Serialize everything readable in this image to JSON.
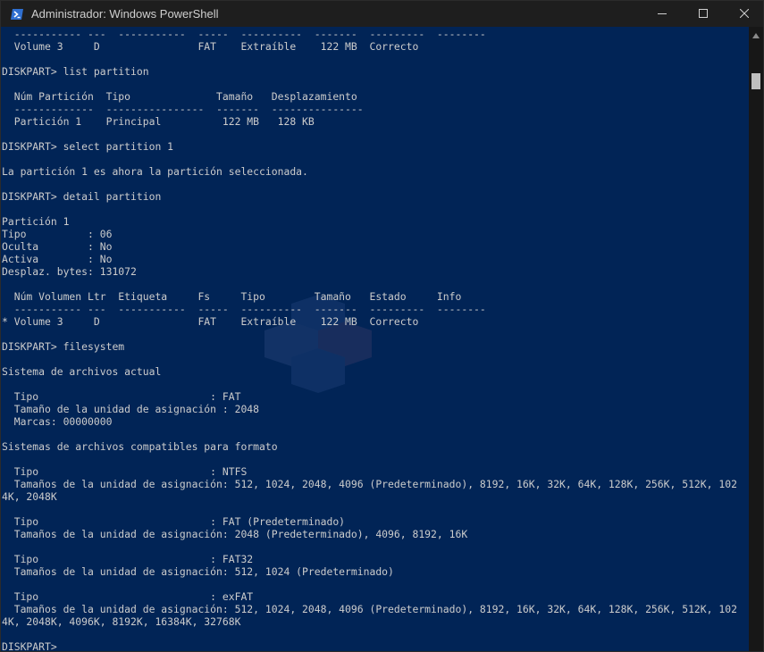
{
  "window": {
    "title": "Administrador: Windows PowerShell"
  },
  "console_lines": [
    "  ----------- ---  -----------  -----  ----------  -------  ---------  --------",
    "  Volume 3     D                FAT    Extraíble    122 MB  Correcto",
    "",
    "DISKPART> list partition",
    "",
    "  Núm Partición  Tipo              Tamaño   Desplazamiento",
    "  -------------  ----------------  -------  ---------------",
    "  Partición 1    Principal          122 MB   128 KB",
    "",
    "DISKPART> select partition 1",
    "",
    "La partición 1 es ahora la partición seleccionada.",
    "",
    "DISKPART> detail partition",
    "",
    "Partición 1",
    "Tipo          : 06",
    "Oculta        : No",
    "Activa        : No",
    "Desplaz. bytes: 131072",
    "",
    "  Núm Volumen Ltr  Etiqueta     Fs     Tipo        Tamaño   Estado     Info",
    "  ----------- ---  -----------  -----  ----------  -------  ---------  --------",
    "* Volume 3     D                FAT    Extraíble    122 MB  Correcto",
    "",
    "DISKPART> filesystem",
    "",
    "Sistema de archivos actual",
    "",
    "  Tipo                            : FAT",
    "  Tamaño de la unidad de asignación : 2048",
    "  Marcas: 00000000",
    "",
    "Sistemas de archivos compatibles para formato",
    "",
    "  Tipo                            : NTFS",
    "  Tamaños de la unidad de asignación: 512, 1024, 2048, 4096 (Predeterminado), 8192, 16K, 32K, 64K, 128K, 256K, 512K, 102",
    "4K, 2048K",
    "",
    "  Tipo                            : FAT (Predeterminado)",
    "  Tamaños de la unidad de asignación: 2048 (Predeterminado), 4096, 8192, 16K",
    "",
    "  Tipo                            : FAT32",
    "  Tamaños de la unidad de asignación: 512, 1024 (Predeterminado)",
    "",
    "  Tipo                            : exFAT",
    "  Tamaños de la unidad de asignación: 512, 1024, 2048, 4096 (Predeterminado), 8192, 16K, 32K, 64K, 128K, 256K, 512K, 102",
    "4K, 2048K, 4096K, 8192K, 16384K, 32768K",
    "",
    "DISKPART>"
  ],
  "colors": {
    "console_bg": "#012456",
    "console_fg": "#cccccc",
    "titlebar_bg": "#1e1e1e",
    "scrollbar_bg": "#171717"
  },
  "icons": {
    "app": "powershell-icon",
    "minimize": "minimize-icon",
    "maximize": "maximize-icon",
    "close": "close-icon"
  }
}
